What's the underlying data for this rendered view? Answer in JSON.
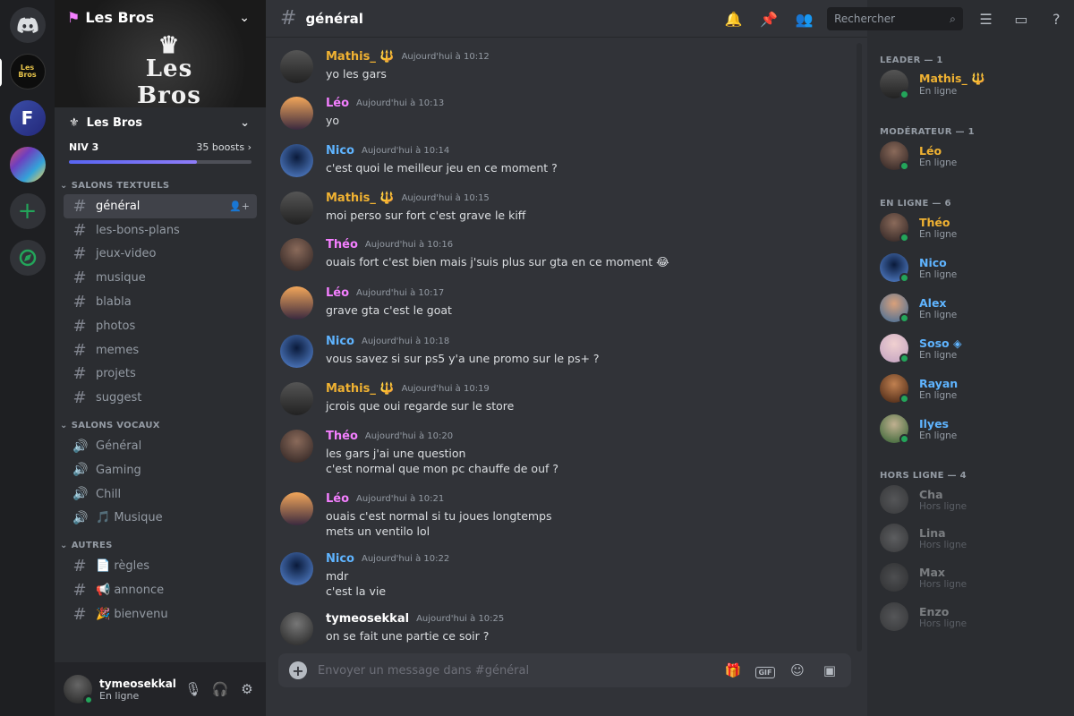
{
  "servers": {
    "lesbros_label": "Les Bros",
    "f_label": "F"
  },
  "guild": {
    "name": "Les Bros",
    "banner_text": "Les Bros",
    "subheader": "Les Bros",
    "level": "NIV 3",
    "boosts": "35 boosts",
    "boost_progress": 0.7
  },
  "categories": {
    "text": "SALONS TEXTUELS",
    "voice": "SALONS VOCAUX",
    "other": "AUTRES"
  },
  "text_channels": [
    "général",
    "les-bons-plans",
    "jeux-video",
    "musique",
    "blabla",
    "photos",
    "memes",
    "projets",
    "suggest"
  ],
  "voice_channels": [
    "Général",
    "Gaming",
    "Chill",
    "🎵 Musique"
  ],
  "other_channels": [
    "📄 règles",
    "📢 annonce",
    "🎉 bienvenu"
  ],
  "user": {
    "name": "tymeosekkal",
    "status": "En ligne"
  },
  "channel": {
    "title": "général"
  },
  "search": {
    "placeholder": "Rechercher"
  },
  "composer": {
    "placeholder": "Envoyer un message dans #général"
  },
  "messages": [
    {
      "author": "Mathis_ 🔱",
      "color": "#f0b232",
      "time": "Aujourd'hui à 10:12",
      "lines": [
        "yo les gars"
      ]
    },
    {
      "author": "Léo",
      "color": "#f47fff",
      "time": "Aujourd'hui à 10:13",
      "lines": [
        "yo"
      ]
    },
    {
      "author": "Nico",
      "color": "#5fb4ff",
      "time": "Aujourd'hui à 10:14",
      "lines": [
        "c'est quoi le meilleur jeu en ce moment ?"
      ]
    },
    {
      "author": "Mathis_ 🔱",
      "color": "#f0b232",
      "time": "Aujourd'hui à 10:15",
      "lines": [
        "moi perso sur fort c'est grave le kiff"
      ]
    },
    {
      "author": "Théo",
      "color": "#f47fff",
      "time": "Aujourd'hui à 10:16",
      "lines": [
        "ouais fort c'est bien mais j'suis plus sur gta en ce moment 😂"
      ]
    },
    {
      "author": "Léo",
      "color": "#f47fff",
      "time": "Aujourd'hui à 10:17",
      "lines": [
        "grave gta c'est le goat"
      ]
    },
    {
      "author": "Nico",
      "color": "#5fb4ff",
      "time": "Aujourd'hui à 10:18",
      "lines": [
        "vous savez si sur ps5 y'a une promo sur le ps+ ?"
      ]
    },
    {
      "author": "Mathis_ 🔱",
      "color": "#f0b232",
      "time": "Aujourd'hui à 10:19",
      "lines": [
        "jcrois que oui regarde sur le store"
      ]
    },
    {
      "author": "Théo",
      "color": "#f47fff",
      "time": "Aujourd'hui à 10:20",
      "lines": [
        "les gars j'ai une question",
        "c'est normal que mon pc chauffe de ouf ?"
      ]
    },
    {
      "author": "Léo",
      "color": "#f47fff",
      "time": "Aujourd'hui à 10:21",
      "lines": [
        "ouais c'est normal si tu joues longtemps",
        "mets un ventilo lol"
      ]
    },
    {
      "author": "Nico",
      "color": "#5fb4ff",
      "time": "Aujourd'hui à 10:22",
      "lines": [
        "mdr",
        "c'est la vie"
      ]
    },
    {
      "author": "tymeosekkal",
      "color": "#ffffff",
      "time": "Aujourd'hui à 10:25",
      "lines": [
        "on se fait une partie ce soir ?"
      ]
    }
  ],
  "member_groups": [
    {
      "title": "LEADER — 1",
      "members": [
        {
          "name": "Mathis_ 🔱",
          "status": "En ligne",
          "color": "#f0b232",
          "online": true
        }
      ]
    },
    {
      "title": "MODÉRATEUR — 1",
      "members": [
        {
          "name": "Léo",
          "status": "En ligne",
          "color": "#f0b232",
          "online": true
        }
      ]
    },
    {
      "title": "EN LIGNE — 6",
      "members": [
        {
          "name": "Théo",
          "status": "En ligne",
          "color": "#f0b232",
          "online": true
        },
        {
          "name": "Nico",
          "status": "En ligne",
          "color": "#5fb4ff",
          "online": true
        },
        {
          "name": "Alex",
          "status": "En ligne",
          "color": "#5fb4ff",
          "online": true
        },
        {
          "name": "Soso ◈",
          "status": "En ligne",
          "color": "#5fb4ff",
          "online": true
        },
        {
          "name": "Rayan",
          "status": "En ligne",
          "color": "#5fb4ff",
          "online": true
        },
        {
          "name": "Ilyes",
          "status": "En ligne",
          "color": "#5fb4ff",
          "online": true
        }
      ]
    },
    {
      "title": "HORS LIGNE — 4",
      "members": [
        {
          "name": "Cha",
          "status": "Hors ligne",
          "color": "#dbdee1",
          "online": false
        },
        {
          "name": "Lina",
          "status": "Hors ligne",
          "color": "#dbdee1",
          "online": false
        },
        {
          "name": "Max",
          "status": "Hors ligne",
          "color": "#dbdee1",
          "online": false
        },
        {
          "name": "Enzo",
          "status": "Hors ligne",
          "color": "#dbdee1",
          "online": false
        }
      ]
    }
  ]
}
